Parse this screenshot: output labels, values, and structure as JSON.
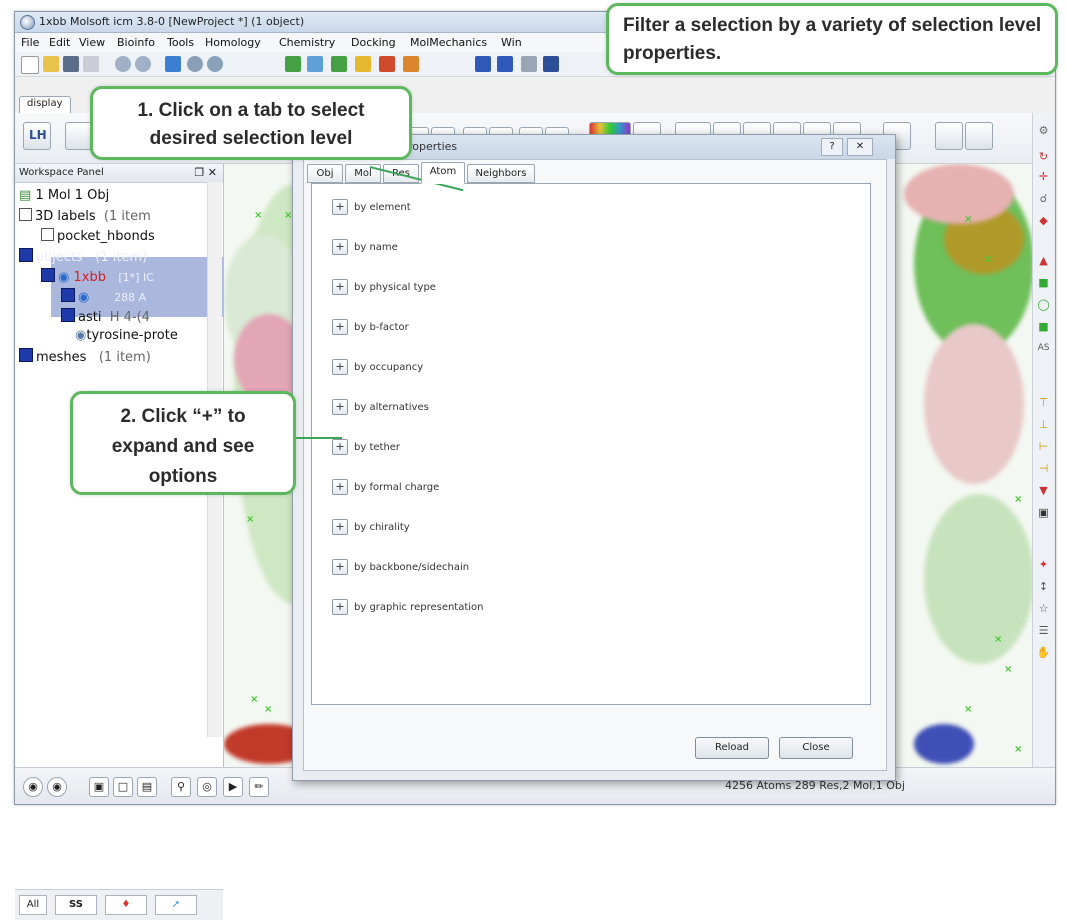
{
  "window": {
    "title": "1xbb Molsoft icm 3.8-0  [NewProject *] (1 object)"
  },
  "menu": [
    "File",
    "Edit",
    "View",
    "Bioinfo",
    "Tools",
    "Homology",
    "Chemistry",
    "Docking",
    "MolMechanics",
    "Win"
  ],
  "ribbon_tabs": [
    "display"
  ],
  "workspace": {
    "header": "Workspace Panel",
    "header_icons": "❐  ✕",
    "tree": {
      "root": "1 Mol 1 Obj",
      "labels": "3D labels",
      "labels_count": "(1 item",
      "pocket": "pocket_hbonds",
      "objects": "objects",
      "objects_count": "(1 item)",
      "obj_name": "1xbb",
      "obj_extra": "[1*] IC",
      "sub1_extra": "288 A",
      "asti": "asti",
      "asti_extra": "H  4-(4",
      "tyrosine": "tyrosine-prote",
      "meshes": "meshes",
      "meshes_count": "(1 item)"
    },
    "bottom_tabs": [
      "All",
      "SS",
      "",
      ""
    ]
  },
  "dialog": {
    "title": "properties",
    "tabs": [
      "Obj",
      "Mol",
      "Res",
      "Atom",
      "Neighbors"
    ],
    "active_tab": "Atom",
    "options": [
      "by element",
      "by name",
      "by physical type",
      "by b-factor",
      "by occupancy",
      "by alternatives",
      "by tether",
      "by formal charge",
      "by chirality",
      "by backbone/sidechain",
      "by graphic representation"
    ],
    "buttons": {
      "reload": "Reload",
      "close": "Close"
    },
    "help_glyph": "?",
    "close_glyph": "✕"
  },
  "status_bar": {
    "text": "4256 Atoms 289 Res,2 Mol,1 Obj"
  },
  "callouts": {
    "filter": "Filter a selection by a variety of selection level properties.",
    "tab": "1. Click on a tab to select desired selection level",
    "plus": "2. Click “+” to expand and see options"
  },
  "colors": {
    "callout_border": "#5cb85c",
    "selection_highlight": "#a9b8dc",
    "object_name": "#d62020"
  }
}
